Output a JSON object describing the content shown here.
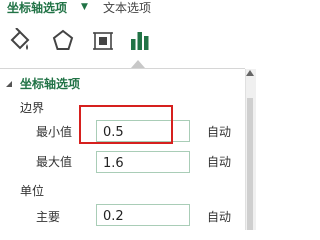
{
  "tabs": {
    "axis_options": "坐标轴选项",
    "text_options": "文本选项"
  },
  "icons": [
    {
      "name": "fill-line-icon",
      "glyph": "◇"
    },
    {
      "name": "effects-icon",
      "glyph": "⬠"
    },
    {
      "name": "size-properties-icon",
      "glyph": "⊞"
    },
    {
      "name": "axis-options-icon",
      "glyph": "▮"
    }
  ],
  "section": {
    "title": "坐标轴选项"
  },
  "bounds": {
    "heading": "边界",
    "min_label": "最小值",
    "min_value": "0.5",
    "max_label": "最大值",
    "max_value": "1.6",
    "auto_label": "自动"
  },
  "units": {
    "heading": "单位",
    "major_label": "主要",
    "major_value": "0.2",
    "auto_label": "自动"
  },
  "colors": {
    "accent": "#217346",
    "highlight": "#d6201e"
  }
}
